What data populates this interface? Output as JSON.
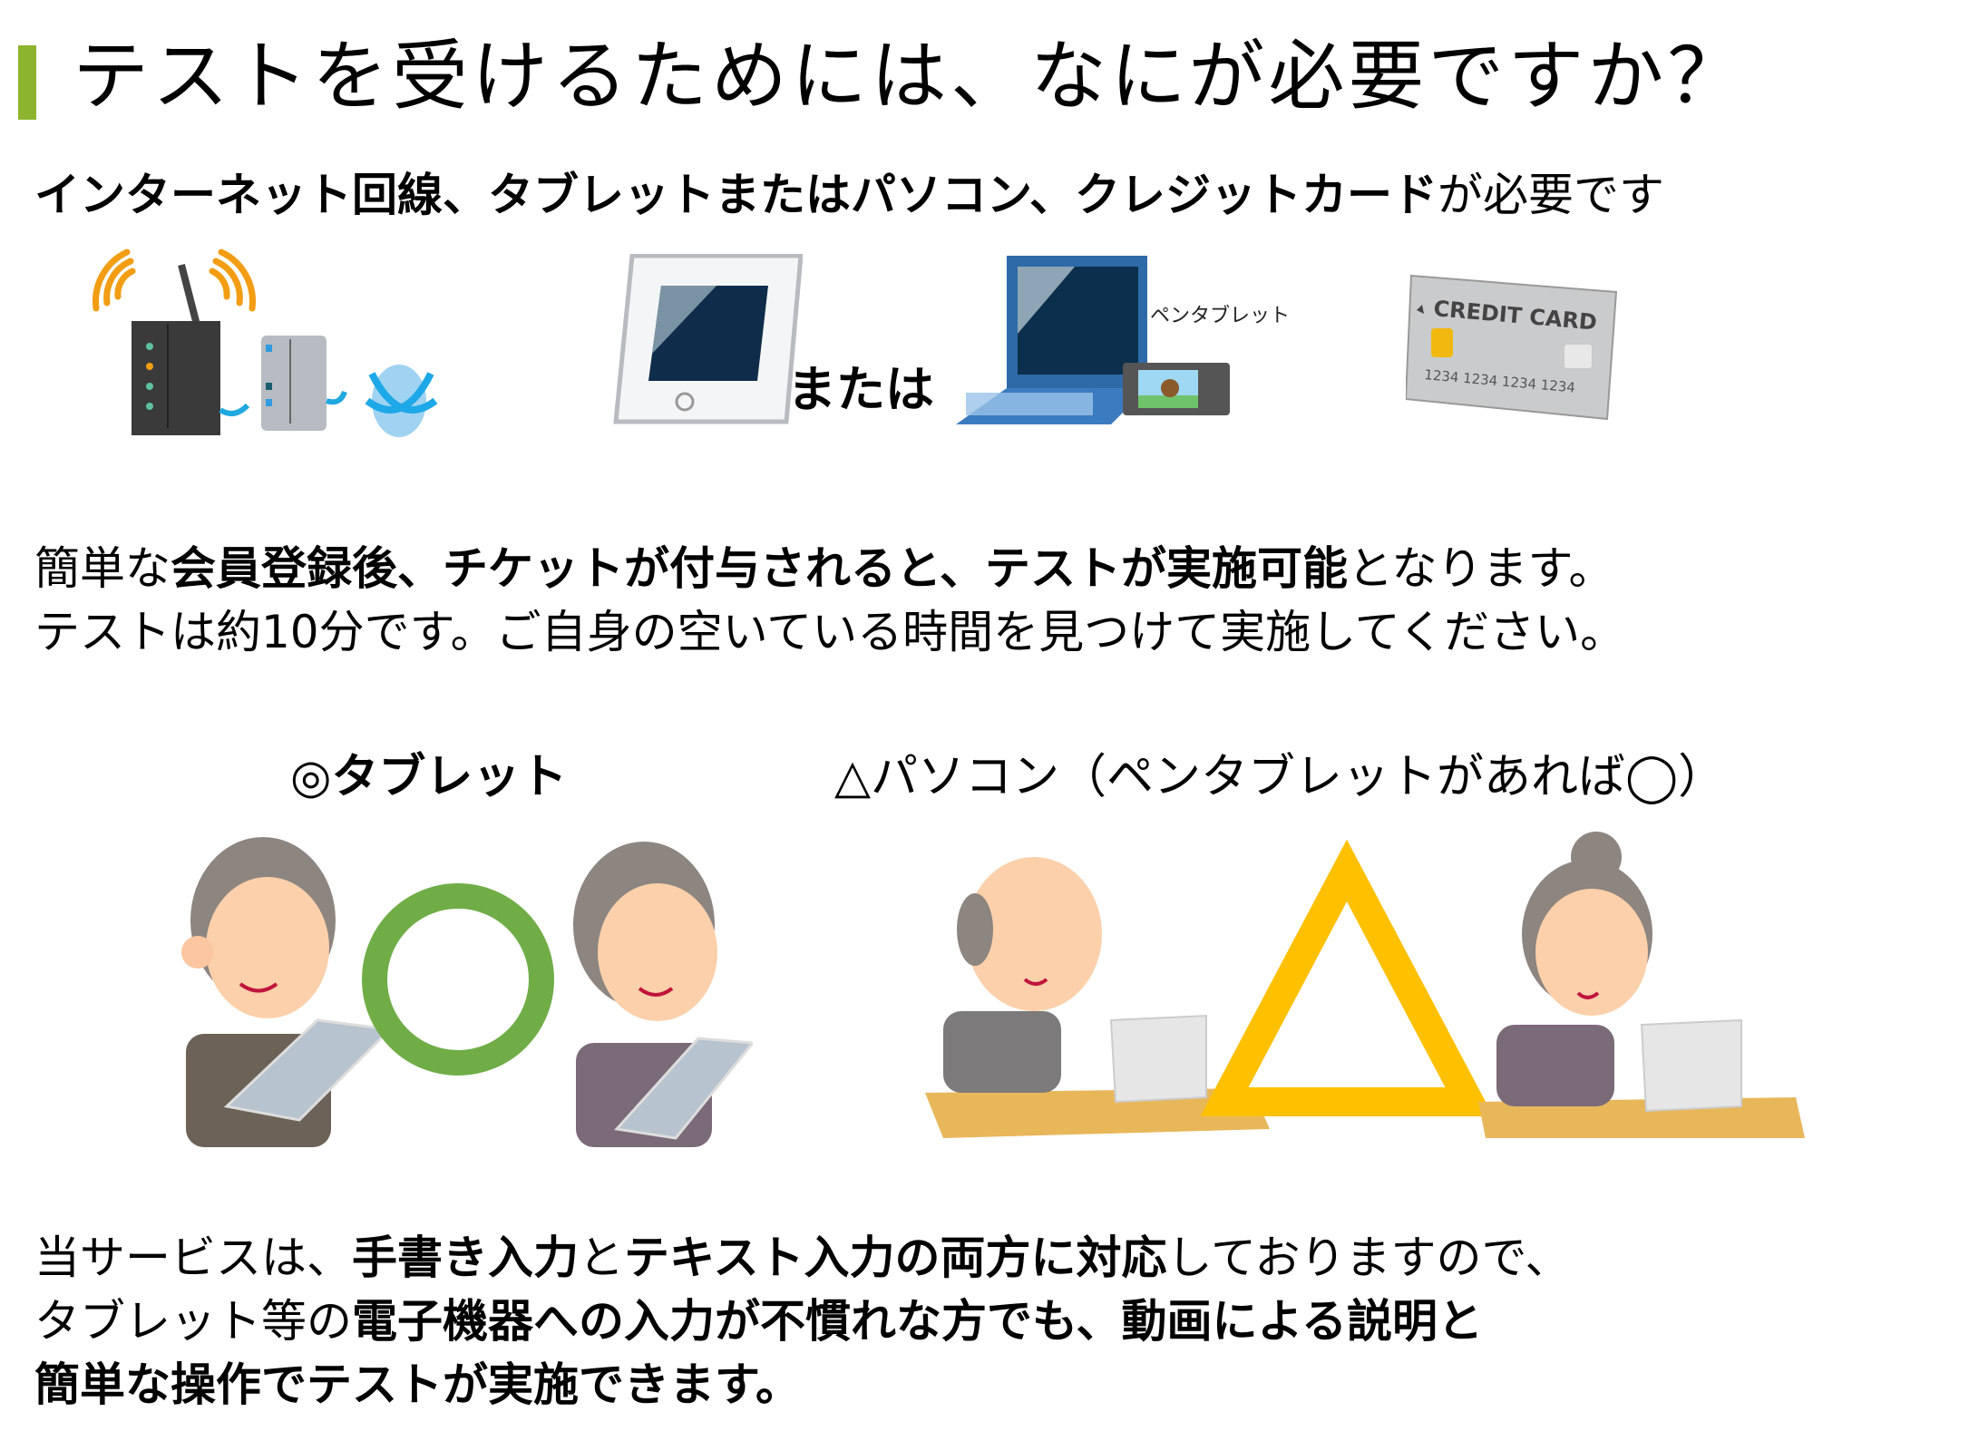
{
  "title": "テストを受けるためには、なにが必要ですか？",
  "requirements": {
    "bold_items": "インターネット回線、タブレットまたはパソコン、クレジットカード",
    "suffix": "が必要です"
  },
  "devices": {
    "router_alt": "wifi-router",
    "or_label": "または",
    "pen_tablet_label": "ペンタブレット",
    "credit_card": {
      "brand_text": "CREDIT CARD",
      "number": "1234 1234 1234 1234"
    }
  },
  "info": {
    "line1": [
      {
        "text": "簡単な",
        "bold": false
      },
      {
        "text": "会員登録後、チケットが付与されると、テストが実施可能",
        "bold": true
      },
      {
        "text": "となります。",
        "bold": false
      }
    ],
    "line2": "テストは約10分です。ご自身の空いている時間を見つけて実施してください。"
  },
  "comparison": {
    "tablet": {
      "label": "◎タブレット",
      "rating_mark": "circle",
      "color": "#70ad47"
    },
    "pc": {
      "label": "△パソコン（ペンタブレットがあれば◯）",
      "rating_mark": "triangle",
      "color": "#ffc000"
    }
  },
  "footer": {
    "line1": [
      {
        "text": "当サービスは、",
        "bold": false
      },
      {
        "text": "手書き入力",
        "bold": true
      },
      {
        "text": "と",
        "bold": false
      },
      {
        "text": "テキスト入力の両方に対応",
        "bold": true
      },
      {
        "text": "しておりますので、",
        "bold": false
      }
    ],
    "line2": [
      {
        "text": "タブレット等の",
        "bold": false
      },
      {
        "text": "電子機器への入力が不慣れな方でも、動画による説明と",
        "bold": true
      }
    ],
    "line3": [
      {
        "text": "簡単な操作でテストが実施できます。",
        "bold": true
      }
    ]
  },
  "colors": {
    "accent_bar": "#8db42e",
    "circle": "#70ad47",
    "triangle": "#ffc000"
  }
}
